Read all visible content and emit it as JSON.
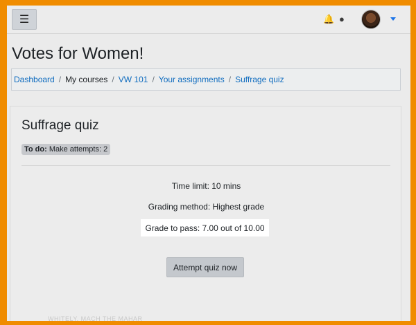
{
  "navbar": {
    "menu_icon": "hamburger-icon",
    "notification_icon": "bell-icon",
    "messages_icon": "chat-bubble-icon",
    "user_menu_icon": "caret-down-icon"
  },
  "page": {
    "title": "Votes for Women!"
  },
  "breadcrumb": {
    "items": [
      "Dashboard",
      "My courses",
      "VW 101",
      "Your assignments",
      "Suffrage quiz"
    ],
    "separator": "/"
  },
  "quiz": {
    "title": "Suffrage quiz",
    "todo_label": "To do:",
    "todo_text": "Make attempts: 2",
    "time_limit": "Time limit: 10 mins",
    "grading_method": "Grading method: Highest grade",
    "grade_to_pass": "Grade to pass: 7.00 out of 10.00",
    "attempt_button": "Attempt quiz now",
    "footer_faded": "WHITELY, MACH THE MAHAR"
  },
  "colors": {
    "border": "#f08c00",
    "link": "#0f6cbf",
    "accent": "#1a73e8"
  }
}
